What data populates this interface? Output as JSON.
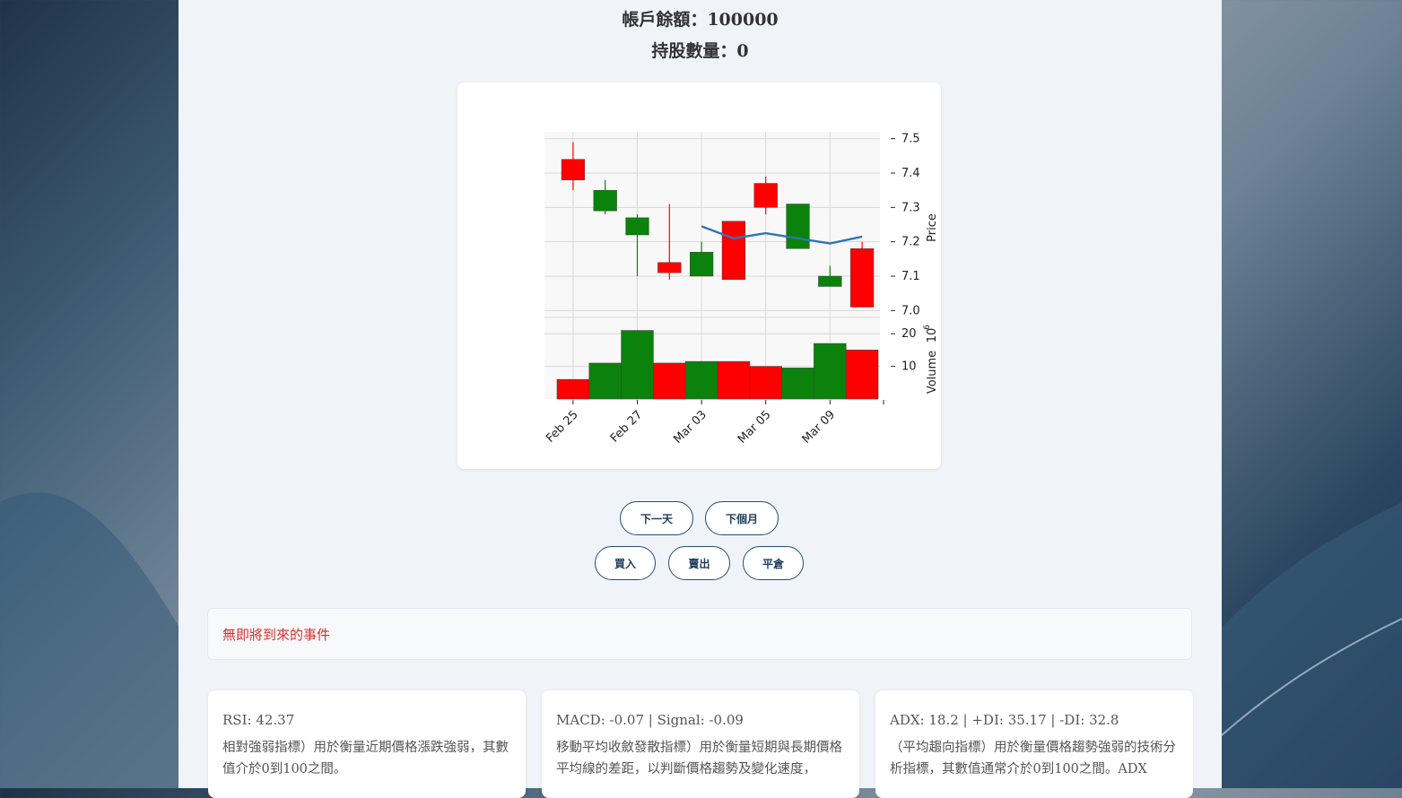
{
  "account": {
    "balance_text": "帳戶餘額：100000",
    "holdings_text": "持股數量：0"
  },
  "chart_data": {
    "type": "candlestick",
    "price_ylabel": "Price",
    "volume_ylabel": "Volume",
    "volume_exponent": "6",
    "price_ylim": [
      6.98,
      7.52
    ],
    "price_ticks": [
      "7.0",
      "7.1",
      "7.2",
      "7.3",
      "7.4",
      "7.5"
    ],
    "volume_ticks": [
      "10",
      "20"
    ],
    "x_tick_labels": [
      "Feb 25",
      "Feb 27",
      "Mar 03",
      "Mar 05",
      "Mar 09"
    ],
    "candles": [
      {
        "open": 7.38,
        "high": 7.49,
        "low": 7.35,
        "close": 7.44,
        "volume": 6,
        "direction": "up"
      },
      {
        "open": 7.35,
        "high": 7.38,
        "low": 7.28,
        "close": 7.29,
        "volume": 11,
        "direction": "down"
      },
      {
        "open": 7.27,
        "high": 7.28,
        "low": 7.1,
        "close": 7.22,
        "volume": 21,
        "direction": "down"
      },
      {
        "open": 7.11,
        "high": 7.31,
        "low": 7.09,
        "close": 7.14,
        "volume": 11,
        "direction": "up"
      },
      {
        "open": 7.17,
        "high": 7.2,
        "low": 7.1,
        "close": 7.1,
        "volume": 11.5,
        "direction": "down"
      },
      {
        "open": 7.09,
        "high": 7.26,
        "low": 7.09,
        "close": 7.26,
        "volume": 11.5,
        "direction": "up"
      },
      {
        "open": 7.3,
        "high": 7.39,
        "low": 7.28,
        "close": 7.37,
        "volume": 10,
        "direction": "up"
      },
      {
        "open": 7.31,
        "high": 7.31,
        "low": 7.18,
        "close": 7.18,
        "volume": 9.5,
        "direction": "down"
      },
      {
        "open": 7.1,
        "high": 7.13,
        "low": 7.07,
        "close": 7.07,
        "volume": 17,
        "direction": "down"
      },
      {
        "open": 7.01,
        "high": 7.2,
        "low": 7.01,
        "close": 7.18,
        "volume": 15,
        "direction": "up"
      }
    ],
    "moving_average": [
      null,
      null,
      null,
      null,
      7.245,
      7.21,
      7.225,
      7.21,
      7.195,
      7.215
    ],
    "colors": {
      "up": "#ff0000",
      "down": "#0b820b",
      "ma": "#2e75b6",
      "grid": "#d9d9d9",
      "plot_bg": "#f8f8f8"
    }
  },
  "controls": {
    "next_day": "下一天",
    "next_month": "下個月",
    "buy": "買入",
    "sell": "賣出",
    "close_position": "平倉"
  },
  "events": {
    "message": "無即將到來的事件",
    "color": "#d9302c"
  },
  "indicators": [
    {
      "title": "RSI: 42.37",
      "description": "相對強弱指標）用於衡量近期價格漲跌強弱，其數值介於0到100之間。"
    },
    {
      "title": "MACD: -0.07 | Signal: -0.09",
      "description": "移動平均收斂發散指標）用於衡量短期與長期價格平均線的差距，以判斷價格趨勢及變化速度，"
    },
    {
      "title": "ADX: 18.2 | +DI: 35.17 | -DI: 32.8",
      "description": "（平均趨向指標）用於衡量價格趨勢強弱的技術分析指標，其數值通常介於0到100之間。ADX"
    }
  ]
}
